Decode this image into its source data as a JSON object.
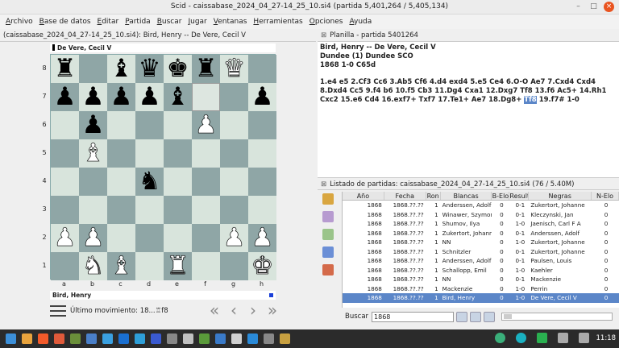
{
  "window": {
    "title": "Scid - caissabase_2024_04_27-14_25_10.si4 (partida 5,401,264 / 5,405,134)",
    "min": "–",
    "max": "□",
    "close": "×"
  },
  "menu": [
    {
      "pre": "",
      "u": "A",
      "post": "rchivo"
    },
    {
      "pre": "",
      "u": "B",
      "post": "ase de datos"
    },
    {
      "pre": "",
      "u": "E",
      "post": "ditar"
    },
    {
      "pre": "",
      "u": "P",
      "post": "artida"
    },
    {
      "pre": "",
      "u": "B",
      "post": "uscar"
    },
    {
      "pre": "",
      "u": "J",
      "post": "ugar"
    },
    {
      "pre": "",
      "u": "V",
      "post": "entanas"
    },
    {
      "pre": "",
      "u": "H",
      "post": "erramientas"
    },
    {
      "pre": "",
      "u": "O",
      "post": "pciones"
    },
    {
      "pre": "",
      "u": "A",
      "post": "yuda"
    }
  ],
  "left": {
    "tab": "(caissabase_2024_04_27-14_25_10.si4): Bird, Henry -- De Vere, Cecil V",
    "top_player": "De Vere, Cecil V",
    "bottom_player": "Bird, Henry",
    "ranks": [
      "8",
      "7",
      "6",
      "5",
      "4",
      "3",
      "2",
      "1"
    ],
    "files": [
      "a",
      "b",
      "c",
      "d",
      "e",
      "f",
      "g",
      "h"
    ],
    "last_move": "Último movimiento: 18...♖f8",
    "nav": [
      "«",
      "‹",
      "›",
      "»"
    ],
    "board": [
      [
        "br",
        "",
        "bb",
        "bq",
        "bk",
        "br",
        "wq",
        ""
      ],
      [
        "bp",
        "bp",
        "bp",
        "bp",
        "bb",
        "",
        "",
        "bp"
      ],
      [
        "",
        "bp",
        "",
        "",
        "",
        "wp",
        "",
        ""
      ],
      [
        "",
        "wb",
        "",
        "",
        "",
        "",
        "",
        ""
      ],
      [
        "",
        "",
        "",
        "bn",
        "",
        "",
        "",
        ""
      ],
      [
        "",
        "",
        "",
        "",
        "",
        "",
        "",
        ""
      ],
      [
        "wp",
        "wp",
        "",
        "",
        "",
        "",
        "wp",
        "wp"
      ],
      [
        "",
        "wn",
        "wb",
        "",
        "wr",
        "",
        "",
        "wk"
      ]
    ],
    "highlight": [
      [
        1,
        5
      ]
    ]
  },
  "planilla": {
    "tab": "Planilla - partida 5401264",
    "header": [
      "Bird, Henry   --   De Vere, Cecil V",
      "Dundee (1)  Dundee SCO",
      "1868  1-0  C65d"
    ],
    "moves_before": "1.e4 e5 2.Cf3 Cc6 3.Ab5 Cf6 4.d4 exd4 5.e5 Ce4 6.O-O Ae7 7.Cxd4 Cxd4 8.Dxd4 Cc5 9.f4 b6 10.f5 Cb3 11.Dg4 Cxa1 12.Dxg7 Tf8 13.f6 Ac5+ 14.Rh1 Cxc2 15.e6 Cd4 16.exf7+ Txf7 17.Te1+ Ae7 18.Dg8+",
    "moves_current": "Tf8",
    "moves_after": "19.f7# 1-0"
  },
  "game_list": {
    "tab": "Listado de partidas: caissabase_2024_04_27-14_25_10.si4 (76 / 5.40M)",
    "columns": [
      "Año",
      "Fecha",
      "Ron",
      "Blancas",
      "B-Elo",
      "Resulta",
      "Negras",
      "N-Elo"
    ],
    "rows": [
      [
        "1868",
        "1868.??.??",
        "1",
        "Anderssen, Adolf",
        "0",
        "0-1",
        "Zukertort, Johanne",
        "0"
      ],
      [
        "1868",
        "1868.??.??",
        "1",
        "Winawer, Szymon",
        "0",
        "0-1",
        "Kleczynski, Jan",
        "0"
      ],
      [
        "1868",
        "1868.??.??",
        "1",
        "Shumov, Ilya",
        "0",
        "1-0",
        "Jaenisch, Carl F A",
        "0"
      ],
      [
        "1868",
        "1868.??.??",
        "1",
        "Zukertort, Johanne",
        "0",
        "0-1",
        "Anderssen, Adolf",
        "0"
      ],
      [
        "1868",
        "1868.??.??",
        "1",
        "NN",
        "0",
        "1-0",
        "Zukertort, Johanne",
        "0"
      ],
      [
        "1868",
        "1868.??.??",
        "1",
        "Schnitzler",
        "0",
        "0-1",
        "Zukertort, Johanne",
        "0"
      ],
      [
        "1868",
        "1868.??.??",
        "1",
        "Anderssen, Adolf",
        "0",
        "0-1",
        "Paulsen, Louis",
        "0"
      ],
      [
        "1868",
        "1868.??.??",
        "1",
        "Schallopp, Emil",
        "0",
        "1-0",
        "Kaehler",
        "0"
      ],
      [
        "1868",
        "1868.??.??",
        "1",
        "NN",
        "0",
        "0-1",
        "Mackenzie",
        "0"
      ],
      [
        "1868",
        "1868.??.??",
        "1",
        "Mackenzie",
        "0",
        "1-0",
        "Perrin",
        "0"
      ],
      [
        "1868",
        "1868.??.??",
        "1",
        "Bird, Henry",
        "0",
        "1-0",
        "De Vere, Cecil V",
        "0"
      ]
    ],
    "selected": 10,
    "search_label": "Buscar",
    "search_value": "1868"
  },
  "taskbar": {
    "clock": "11:18"
  },
  "colors": {
    "accent": "#5b86c8",
    "light_square": "#d8e4dc",
    "dark_square": "#8fa6a6",
    "close": "#e95420"
  }
}
